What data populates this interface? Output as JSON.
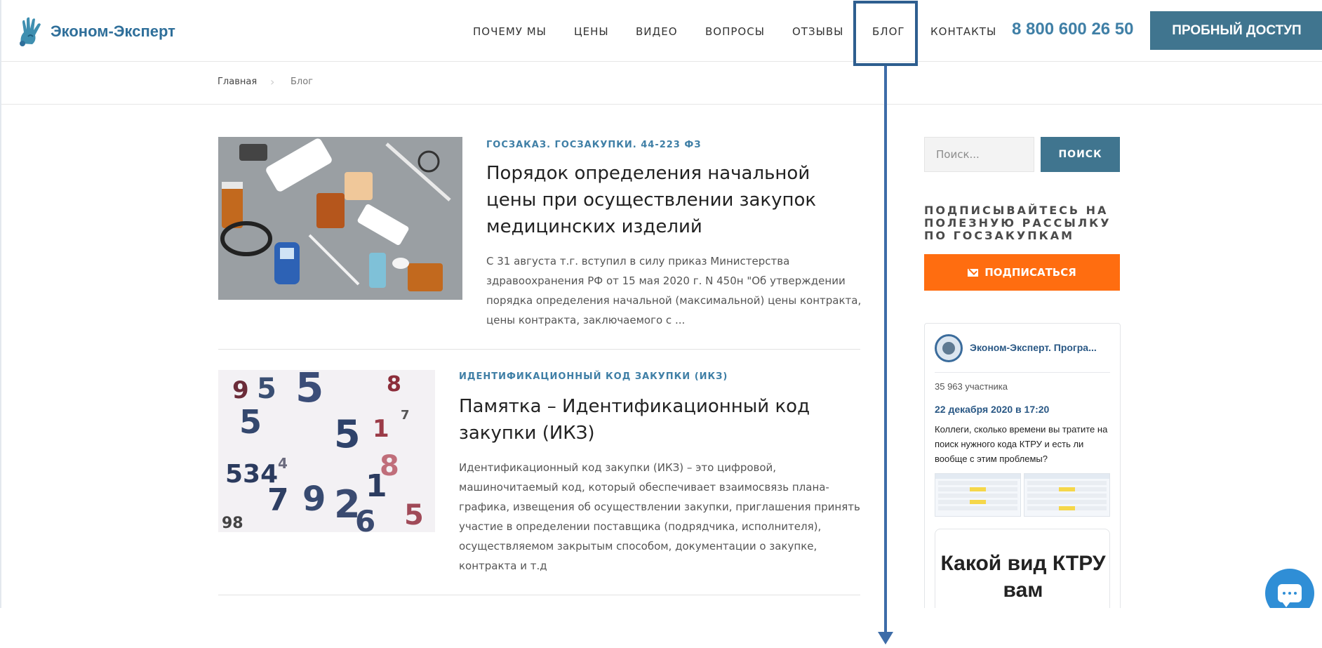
{
  "header": {
    "logo_text": "Эконом-Эксперт",
    "nav": [
      "ПОЧЕМУ МЫ",
      "ЦЕНЫ",
      "ВИДЕО",
      "ВОПРОСЫ",
      "ОТЗЫВЫ",
      "БЛОГ",
      "КОНТАКТЫ"
    ],
    "phone": "8 800 600 26 50",
    "trial_button": "ПРОБНЫЙ ДОСТУП"
  },
  "breadcrumb": {
    "home": "Главная",
    "current": "Блог"
  },
  "articles": [
    {
      "category": "ГОСЗАКАЗ. ГОСЗАКУПКИ. 44-223 ФЗ",
      "title": "Порядок определения начальной цены при осуществлении закупок медицинских изделий",
      "excerpt": "С 31 августа т.г. вступил в силу приказ Министерства здравоохранения РФ от 15 мая 2020 г. N 450н \"Об утверждении порядка определения начальной (максимальной) цены контракта, цены контракта, заключаемого с ..."
    },
    {
      "category": "ИДЕНТИФИКАЦИОННЫЙ КОД ЗАКУПКИ (ИКЗ)",
      "title": "Памятка – Идентификационный код закупки (ИКЗ)",
      "excerpt": "Идентификационный код закупки (ИКЗ) – это цифровой, машиночитаемый код, который обеспечивает взаимосвязь плана-графика, извещения об осуществлении закупки, приглашения принять участие в определении поставщика (подрядчика, исполнителя), осуществляемом закрытым способом, документации о закупке, контракта и т.д"
    }
  ],
  "sidebar": {
    "search_placeholder": "Поиск...",
    "search_button": "ПОИСК",
    "subscribe_heading": "ПОДПИСЫВАЙТЕСЬ НА ПОЛЕЗНУЮ РАССЫЛКУ ПО ГОСЗАКУПКАМ",
    "subscribe_button": "ПОДПИСАТЬСЯ",
    "vk": {
      "name": "Эконом-Эксперт. Програ...",
      "members": "35 963 участника",
      "date": "22 декабря 2020 в 17:20",
      "post": "Коллеги, сколько времени вы тратите на поиск нужного кода КТРУ и есть ли вообще с этим проблемы?",
      "poll_text": "Какой вид КТРУ вам"
    }
  },
  "colors": {
    "brand": "#40758f",
    "link": "#3f7fa6",
    "accent": "#ff6d10",
    "annotation": "#2e5e8f"
  },
  "icons": [
    "logo-hand-icon",
    "mail-icon",
    "chat-icon",
    "vk-avatar"
  ]
}
